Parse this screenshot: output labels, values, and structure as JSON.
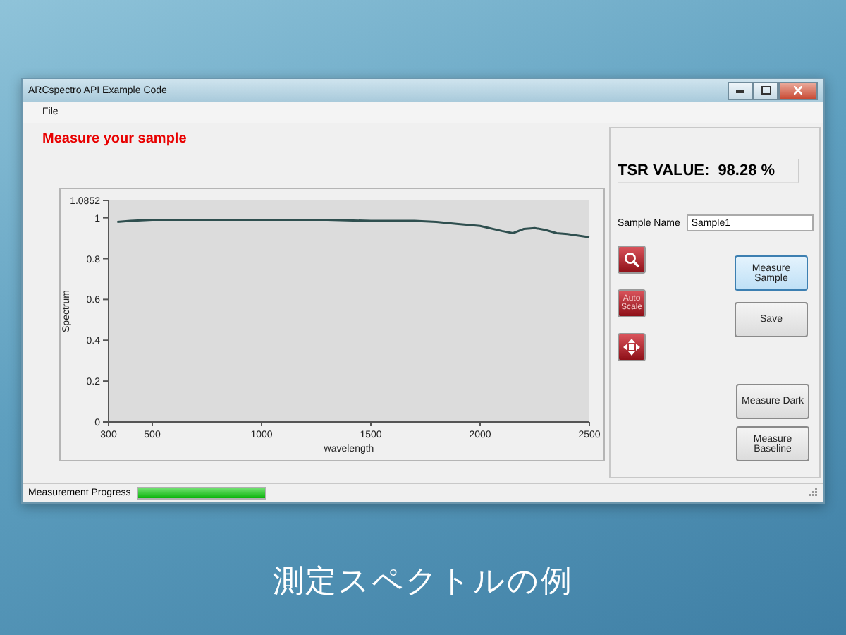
{
  "window": {
    "title": "ARCspectro API Example Code"
  },
  "menu": [
    "File"
  ],
  "heading": "Measure your sample",
  "chart": {
    "chart_data": {
      "type": "line",
      "xlabel": "wavelength",
      "ylabel": "Spectrum",
      "xlim": [
        300,
        2500
      ],
      "ylim": [
        0,
        1.0852
      ],
      "xticks": [
        300,
        500,
        1000,
        1500,
        2000,
        2500
      ],
      "yticks": [
        0,
        0.2,
        0.4,
        0.6,
        0.8,
        1,
        1.0852
      ],
      "x": [
        340,
        400,
        500,
        700,
        1000,
        1300,
        1500,
        1700,
        1800,
        1900,
        2000,
        2100,
        2150,
        2200,
        2250,
        2300,
        2350,
        2400,
        2500
      ],
      "series": [
        {
          "color": "#2f4f4f",
          "values": [
            0.98,
            0.985,
            0.99,
            0.99,
            0.99,
            0.99,
            0.985,
            0.985,
            0.98,
            0.97,
            0.96,
            0.935,
            0.925,
            0.945,
            0.95,
            0.94,
            0.925,
            0.92,
            0.905
          ]
        }
      ]
    }
  },
  "tsr": {
    "label": "TSR VALUE:",
    "value": "98.28 %"
  },
  "sample_name": {
    "label": "Sample Name",
    "value": "Sample1"
  },
  "tools": [
    {
      "kind": "zoom"
    },
    {
      "kind": "text",
      "label": "Auto Scale"
    },
    {
      "kind": "pan"
    }
  ],
  "buttons": [
    {
      "label": "Measure Sample",
      "selected": true
    },
    {
      "label": "Save",
      "selected": false
    }
  ],
  "buttons_lower": [
    {
      "label": "Measure Dark",
      "selected": false
    },
    {
      "label": "Measure Baseline",
      "selected": false
    }
  ],
  "status_bar": {
    "label": "Measurement Progress",
    "level": 1
  },
  "caption": "測定スペクトルの例"
}
